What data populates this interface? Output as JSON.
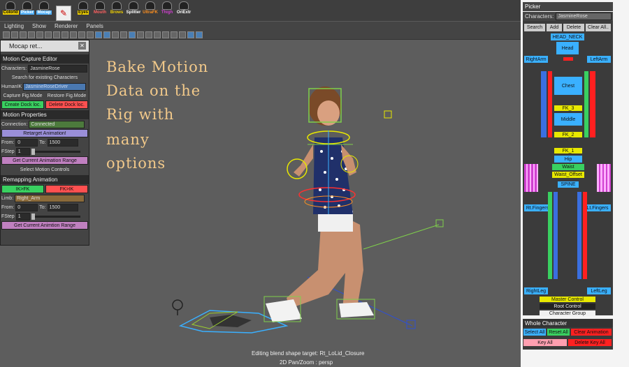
{
  "shelf": {
    "items": [
      {
        "label": "ColorId",
        "color": "#f0d000"
      },
      {
        "label": "Picker",
        "color": "#4fb0ff"
      },
      {
        "label": "Mocap",
        "color": "#4fb0ff"
      },
      {
        "label": "Eyes",
        "color": "#f0d000"
      },
      {
        "label": "Mouth",
        "color": "#ff5050"
      },
      {
        "label": "Brows",
        "color": "#f0d000"
      },
      {
        "label": "Splitter",
        "color": "#ffffff"
      },
      {
        "label": "UltraFK",
        "color": "#ff9020"
      },
      {
        "label": "Thigh",
        "color": "#d040d0"
      },
      {
        "label": "OriExtr",
        "color": "#ffffff"
      }
    ]
  },
  "menubar": {
    "items": [
      "Lighting",
      "Show",
      "Renderer",
      "Panels"
    ]
  },
  "overlay": {
    "lines": [
      "Bake Motion",
      "Data on the",
      "Rig with",
      "many",
      "options"
    ]
  },
  "hud": {
    "status": "Editing blend shape target: Rt_LoLid_Closure",
    "camera": "2D Pan/Zoom : persp"
  },
  "mocap": {
    "title": "Mocap ret...",
    "sec1": "Motion Capture Editor",
    "characters_label": "Characters:",
    "characters_value": "JasmineRose",
    "search_btn": "Search for existing Characters",
    "humanik_label": "HumanIK",
    "humanik_value": "JasmineRoseDriver",
    "capture_btn": "Capture Fig.Mode",
    "restore_btn": "Restore Fig.Mode",
    "create_dock_btn": "Create Dock loc.",
    "delete_dock_btn": "Delete Dock loc.",
    "sec2": "Motion Properties",
    "connection_label": "Connection:",
    "connection_value": "Connected",
    "retarget_btn": "Retarget Animation!",
    "from_label": "From:",
    "from_value": "0",
    "to_label": "To:",
    "to_value": "1500",
    "fstep_label": "FStep",
    "fstep_value": "1",
    "get_range_btn": "Get Current Animation Range",
    "select_controls_btn": "Select Motion Controls",
    "sec3": "Remapping Animation",
    "ik_fk_btn": "IK>FK",
    "fk_ik_btn": "FK>IK",
    "limb_label": "Limb:",
    "limb_value": "Right_Arm",
    "from2_value": "0",
    "to2_value": "1500",
    "fstep2_value": "1",
    "get_range2_btn": "Get Current Animtion Range"
  },
  "picker": {
    "title": "Picker",
    "characters_label": "Characters:",
    "characters_value": "JasmineRose",
    "search_btn": "Search",
    "add_btn": "Add",
    "delete_btn": "Delete",
    "clear_btn": "Clear All..",
    "head_neck": "HEAD_NECK",
    "head": "Head",
    "right_arm": "RightArm",
    "left_arm": "LeftArm",
    "chest": "Chest",
    "fk3": "FK_3",
    "middle": "Middle",
    "fk2": "FK_2",
    "fk1": "FK_1",
    "hip": "Hip",
    "waist": "Waist",
    "waist_offset": "Waist_Offset",
    "spine": "SPINE",
    "rt_fingers": "Rt.Fingers",
    "lt_fingers": "Lt.Fingers",
    "right_leg": "RightLeg",
    "left_leg": "LeftLeg",
    "master_control": "Master Control",
    "root_control": "Root Control",
    "character_group": "Character Group",
    "whole_character": "Whole Character",
    "select_all": "Select All",
    "reset_all": "Reset All",
    "clear_animation": "Clear Animation",
    "key_all": "Key All",
    "delete_key_all": "Delete Key All"
  }
}
